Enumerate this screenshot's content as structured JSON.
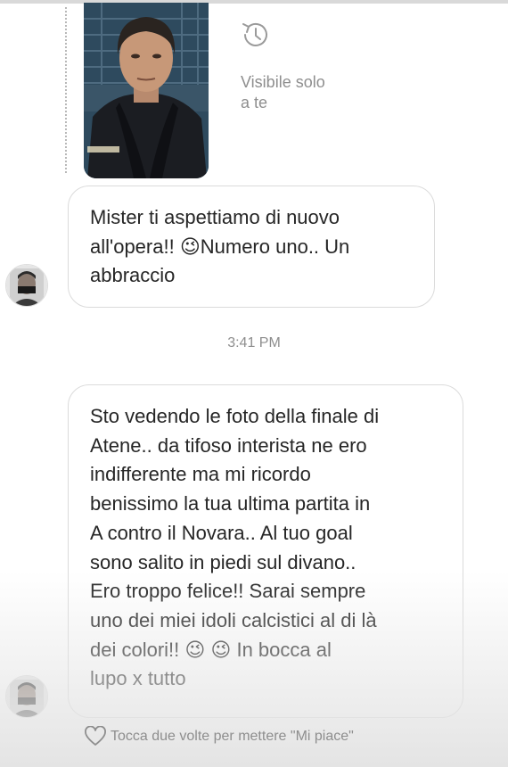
{
  "story_reply": {
    "visibility_label": "Visibile solo\na te",
    "visibility_icon": "history-icon",
    "thumbnail": "story-photo"
  },
  "messages": [
    {
      "id": "msg-1",
      "text": "Mister ti aspettiamo di nuovo\nall'opera!! 😉Numero uno.. Un\nabbraccio"
    },
    {
      "id": "msg-2",
      "text": "Sto vedendo le foto della finale di\nAtene.. da tifoso interista ne ero\nindifferente  ma mi ricordo\nbenissimo la tua ultima partita in\nA contro il Novara.. Al tuo goal\nsono salito in piedi sul divano..\nEro troppo felice!! Sarai sempre\nuno dei miei idoli calcistici al di là\ndei colori!! 😉 😉  In bocca al\nlupo x tutto"
    }
  ],
  "timestamp": "3:41 PM",
  "like_hint": "Tocca due volte per mettere \"Mi piace\"",
  "colors": {
    "bubble_border": "#dbdbdb",
    "secondary_text": "#8e8e8e",
    "primary_text": "#262626"
  }
}
